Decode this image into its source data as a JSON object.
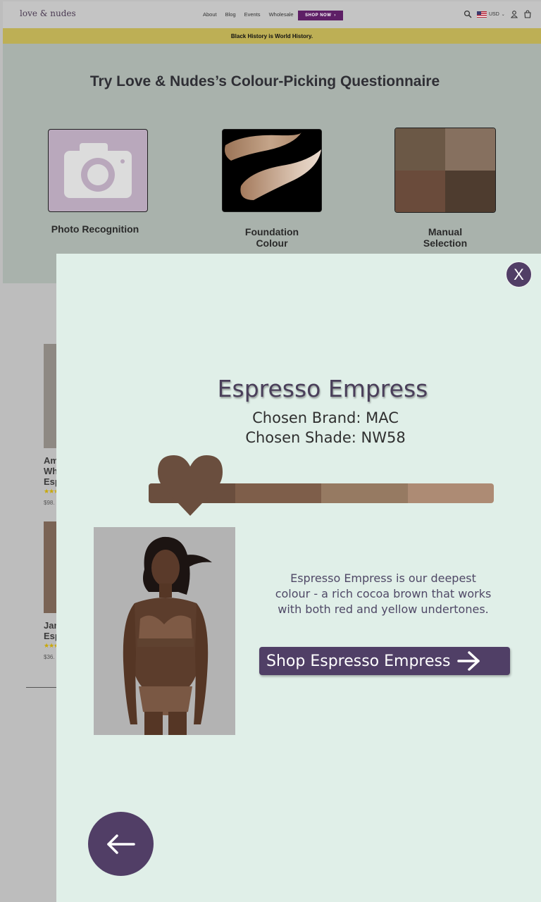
{
  "header": {
    "logo": "love & nudes",
    "nav": [
      "About",
      "Blog",
      "Events",
      "Wholesale"
    ],
    "shop_now": "SHOP NOW",
    "currency": "USD"
  },
  "announcement": "Black History is World History.",
  "quiz": {
    "title": "Try Love & Nudes’s Colour-Picking Questionnaire",
    "options": {
      "photo": "Photo Recognition",
      "foundation_1": "Foundation",
      "foundation_2": "Colour",
      "manual_1": "Manual",
      "manual_2": "Selection"
    },
    "manual_swatches": [
      "#6b5846",
      "#86705f",
      "#6a4b3b",
      "#4e3c2f"
    ]
  },
  "background_products": [
    {
      "line1": "Am",
      "line2": "Wh",
      "line3": "Esp",
      "price": "$98.",
      "stars": "★★★"
    },
    {
      "line1": "Jan",
      "line2": "Esp",
      "price": "$36.",
      "stars": "★★★"
    }
  ],
  "modal": {
    "close": "X",
    "shade_name": "Espresso Empress",
    "brand_line": "Chosen Brand: MAC",
    "shade_line": "Chosen Shade: NW58",
    "shade_bar": [
      "#6a4e3e",
      "#7e5e4a",
      "#967a62",
      "#ad8b74"
    ],
    "description": "Espresso Empress is our deepest colour - a rich cocoa brown that works with both red and yellow undertones.",
    "shop_button": "Shop Espresso Empress",
    "colors": {
      "accent": "#503f66",
      "modal_bg": "#e0efe8"
    }
  }
}
